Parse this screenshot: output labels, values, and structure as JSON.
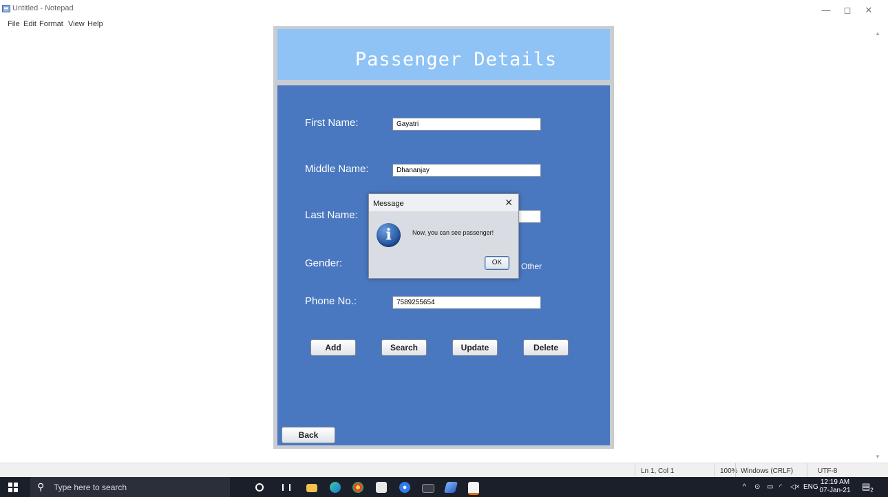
{
  "notepad": {
    "title": "Untitled - Notepad",
    "menu": [
      "File",
      "Edit",
      "Format",
      "View",
      "Help"
    ],
    "window_controls": {
      "minimize": "—",
      "restore": "◻",
      "close": "✕"
    },
    "status": {
      "position": "Ln 1, Col 1",
      "zoom": "100%",
      "line_ending": "Windows (CRLF)",
      "encoding": "UTF-8"
    }
  },
  "app": {
    "header_title": "Passenger Details",
    "fields": {
      "first_name": {
        "label": "First Name:",
        "value": "Gayatri"
      },
      "middle_name": {
        "label": "Middle Name:",
        "value": "Dhananjay"
      },
      "last_name": {
        "label": "Last Name:",
        "value": ""
      },
      "gender": {
        "label": "Gender:",
        "option_visible": "Other"
      },
      "phone": {
        "label": "Phone No.:",
        "value": "7589255654"
      }
    },
    "buttons": {
      "add": "Add",
      "search": "Search",
      "update": "Update",
      "delete": "Delete",
      "back": "Back"
    }
  },
  "dialog": {
    "title": "Message",
    "close": "✕",
    "icon": "info-icon",
    "icon_glyph": "i",
    "message": "Now, you can see passenger!",
    "ok_label": "OK"
  },
  "taskbar": {
    "search_placeholder": "Type here to search",
    "tray": {
      "chevron": "^",
      "language": "ENG",
      "notification_count": "2"
    },
    "clock": {
      "time": "12:19 AM",
      "date": "07-Jan-21"
    }
  },
  "colors": {
    "app_body": "#4a78c0",
    "app_header": "#8fc3f5",
    "taskbar": "#1b1f2a"
  }
}
